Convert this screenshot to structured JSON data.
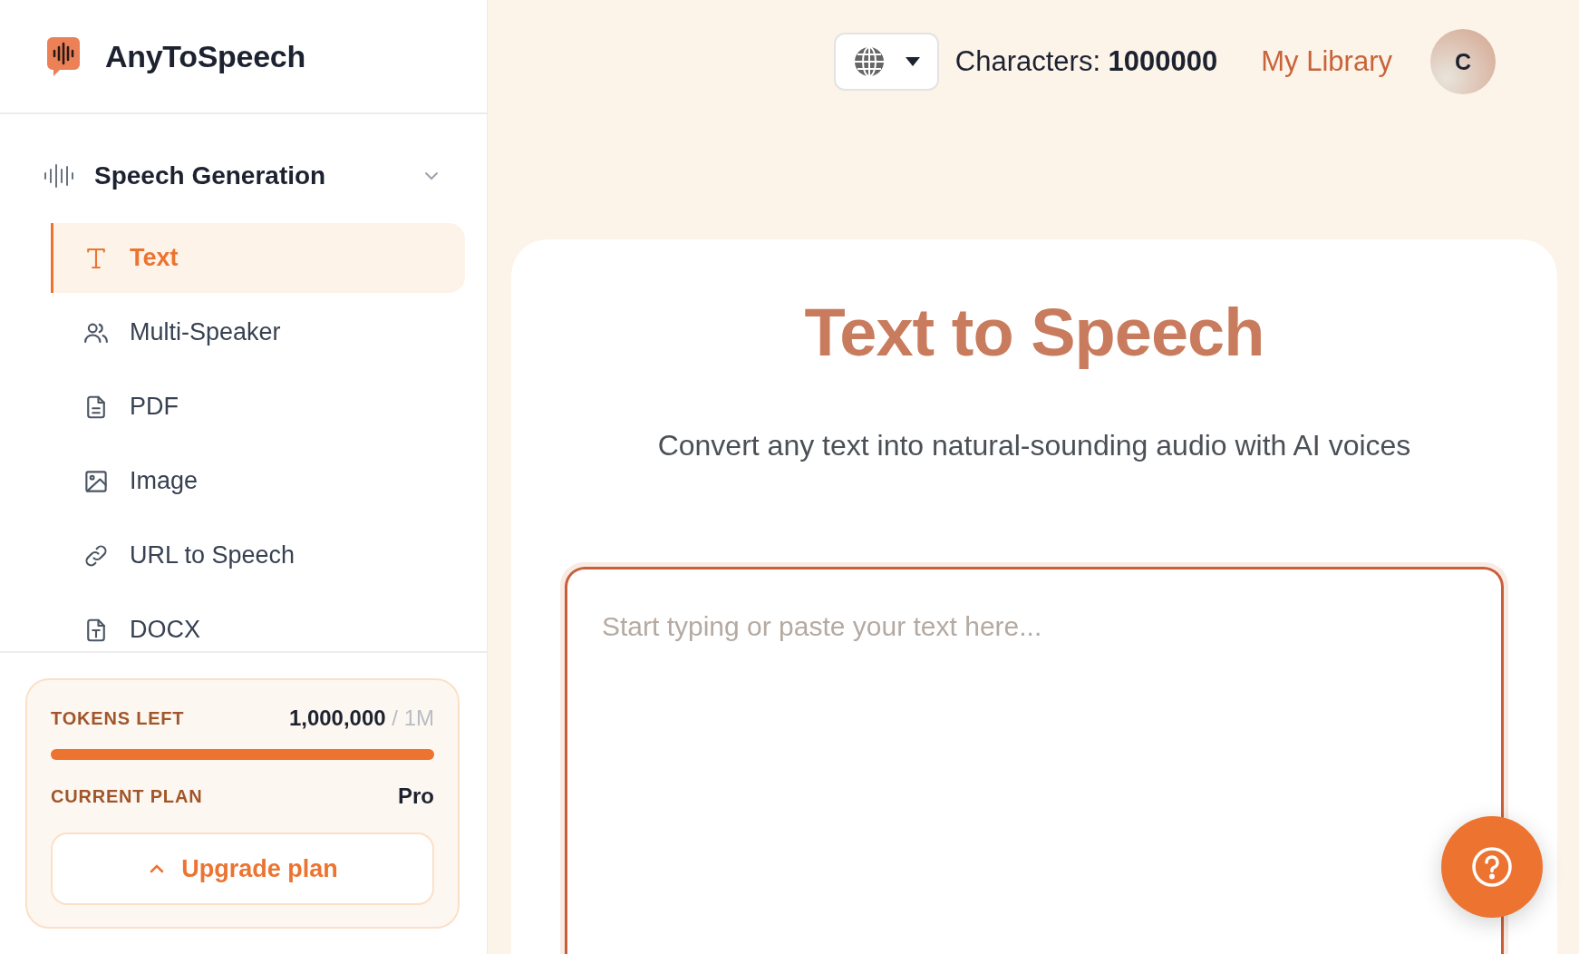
{
  "brand": {
    "name": "AnyToSpeech"
  },
  "sidebar": {
    "section": {
      "label": "Speech Generation",
      "expanded": true
    },
    "items": [
      {
        "label": "Text",
        "kind": "text",
        "selected": true
      },
      {
        "label": "Multi-Speaker",
        "kind": "users",
        "selected": false
      },
      {
        "label": "PDF",
        "kind": "document",
        "selected": false
      },
      {
        "label": "Image",
        "kind": "image",
        "selected": false
      },
      {
        "label": "URL to Speech",
        "kind": "link",
        "selected": false
      },
      {
        "label": "DOCX",
        "kind": "docx",
        "selected": false
      }
    ]
  },
  "usage": {
    "tokens_label": "TOKENS LEFT",
    "tokens_value": "1,000,000",
    "tokens_total": "/ 1M",
    "level": 1,
    "plan_label": "CURRENT PLAN",
    "plan_value": "Pro",
    "upgrade_button": "Upgrade plan"
  },
  "top_bar": {
    "characters_label": "Characters:",
    "characters_value": "1000000",
    "library_link": "My Library",
    "avatar": "C"
  },
  "main": {
    "title": "Text to Speech",
    "subtitle": "Convert any text into natural-sounding audio with AI voices",
    "text_input": {
      "placeholder": "Start typing or paste your text here..."
    }
  }
}
